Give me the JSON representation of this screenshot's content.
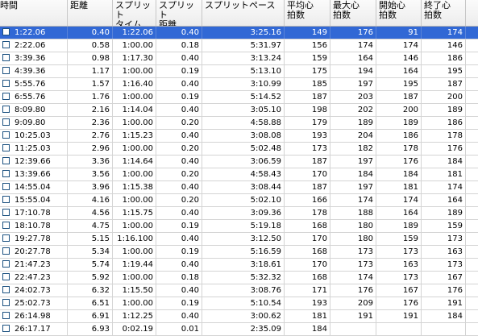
{
  "headers": [
    "時間",
    "距離",
    "スプリット\nタイム",
    "スプリット\n距離",
    "スプリットペース",
    "平均心\n拍数",
    "最大心\n拍数",
    "開始心\n拍数",
    "終了心\n拍数"
  ],
  "rows": [
    [
      "1:22.06",
      "0.40",
      "1:22.06",
      "0.40",
      "3:25.16",
      "149",
      "176",
      "91",
      "174"
    ],
    [
      "2:22.06",
      "0.58",
      "1:00.00",
      "0.18",
      "5:31.97",
      "156",
      "174",
      "174",
      "146"
    ],
    [
      "3:39.36",
      "0.98",
      "1:17.30",
      "0.40",
      "3:13.24",
      "159",
      "164",
      "146",
      "186"
    ],
    [
      "4:39.36",
      "1.17",
      "1:00.00",
      "0.19",
      "5:13.10",
      "175",
      "194",
      "164",
      "195"
    ],
    [
      "5:55.76",
      "1.57",
      "1:16.40",
      "0.40",
      "3:10.99",
      "185",
      "197",
      "195",
      "187"
    ],
    [
      "6:55.76",
      "1.76",
      "1:00.00",
      "0.19",
      "5:14.52",
      "187",
      "203",
      "187",
      "200"
    ],
    [
      "8:09.80",
      "2.16",
      "1:14.04",
      "0.40",
      "3:05.10",
      "198",
      "202",
      "200",
      "189"
    ],
    [
      "9:09.80",
      "2.36",
      "1:00.00",
      "0.20",
      "4:58.88",
      "179",
      "189",
      "189",
      "186"
    ],
    [
      "10:25.03",
      "2.76",
      "1:15.23",
      "0.40",
      "3:08.08",
      "193",
      "204",
      "186",
      "178"
    ],
    [
      "11:25.03",
      "2.96",
      "1:00.00",
      "0.20",
      "5:02.48",
      "173",
      "182",
      "178",
      "176"
    ],
    [
      "12:39.66",
      "3.36",
      "1:14.64",
      "0.40",
      "3:06.59",
      "187",
      "197",
      "176",
      "184"
    ],
    [
      "13:39.66",
      "3.56",
      "1:00.00",
      "0.20",
      "4:58.43",
      "170",
      "184",
      "184",
      "181"
    ],
    [
      "14:55.04",
      "3.96",
      "1:15.38",
      "0.40",
      "3:08.44",
      "187",
      "197",
      "181",
      "174"
    ],
    [
      "15:55.04",
      "4.16",
      "1:00.00",
      "0.20",
      "5:02.10",
      "166",
      "174",
      "174",
      "164"
    ],
    [
      "17:10.78",
      "4.56",
      "1:15.75",
      "0.40",
      "3:09.36",
      "178",
      "188",
      "164",
      "189"
    ],
    [
      "18:10.78",
      "4.75",
      "1:00.00",
      "0.19",
      "5:19.18",
      "168",
      "180",
      "189",
      "159"
    ],
    [
      "19:27.78",
      "5.15",
      "1:16.100",
      "0.40",
      "3:12.50",
      "170",
      "180",
      "159",
      "173"
    ],
    [
      "20:27.78",
      "5.34",
      "1:00.00",
      "0.19",
      "5:16.59",
      "168",
      "173",
      "173",
      "163"
    ],
    [
      "21:47.23",
      "5.74",
      "1:19.44",
      "0.40",
      "3:18.61",
      "170",
      "173",
      "163",
      "173"
    ],
    [
      "22:47.23",
      "5.92",
      "1:00.00",
      "0.18",
      "5:32.32",
      "168",
      "174",
      "173",
      "167"
    ],
    [
      "24:02.73",
      "6.32",
      "1:15.50",
      "0.40",
      "3:08.76",
      "171",
      "176",
      "167",
      "176"
    ],
    [
      "25:02.73",
      "6.51",
      "1:00.00",
      "0.19",
      "5:10.54",
      "193",
      "209",
      "176",
      "191"
    ],
    [
      "26:14.98",
      "6.91",
      "1:12.25",
      "0.40",
      "3:00.62",
      "181",
      "191",
      "191",
      "184"
    ],
    [
      "26:17.17",
      "6.93",
      "0:02.19",
      "0.01",
      "2:35.09",
      "184",
      "",
      "",
      ""
    ]
  ],
  "selected_row": 0,
  "colors": {
    "selection": "#3168d5",
    "grid": "#d4d4d4",
    "checkbox_border": "#1c5180"
  }
}
